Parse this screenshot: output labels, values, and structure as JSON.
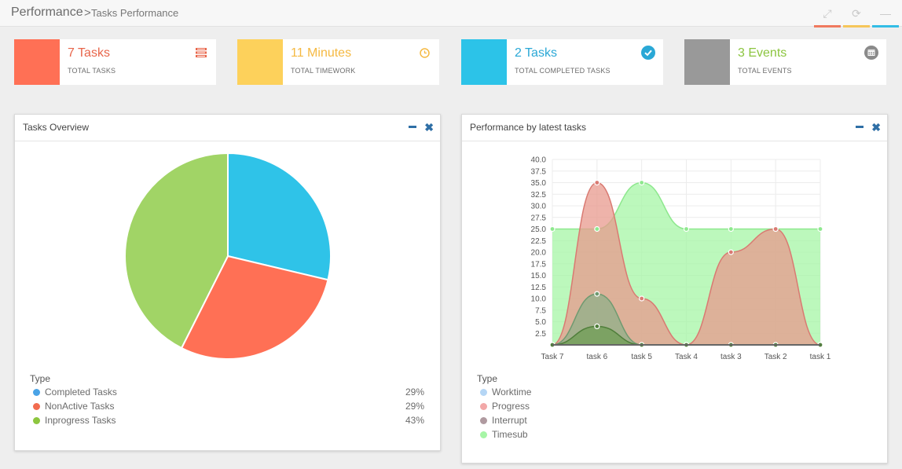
{
  "breadcrumb": {
    "main": "Performance",
    "separator": ">",
    "sub": "Tasks Performance"
  },
  "toolbar": {
    "buttons": [
      {
        "name": "fullscreen",
        "icon": "expand-icon",
        "glyph": "⤢",
        "accent": "#f07a5f"
      },
      {
        "name": "refresh",
        "icon": "refresh-icon",
        "glyph": "⟳",
        "accent": "#f6c65a"
      },
      {
        "name": "collapse",
        "icon": "minus-icon",
        "glyph": "—",
        "accent": "#33bde6"
      }
    ]
  },
  "stats": [
    {
      "value": "7 Tasks",
      "label": "TOTAL TASKS",
      "color": "#ff7055",
      "value_color": "#e8654a",
      "icon": "list-icon"
    },
    {
      "value": "11 Minutes",
      "label": "TOTAL TIMEWORK",
      "color": "#fdd15b",
      "value_color": "#f5b942",
      "icon": "clock-icon"
    },
    {
      "value": "2 Tasks",
      "label": "TOTAL COMPLETED TASKS",
      "color": "#2cc3e8",
      "value_color": "#2aa8d6",
      "icon": "check-circle-icon"
    },
    {
      "value": "3 Events",
      "label": "TOTAL EVENTS",
      "color": "#999999",
      "value_color": "#8cc540",
      "icon": "calendar-icon"
    }
  ],
  "overview": {
    "title": "Tasks Overview",
    "legend_title": "Type",
    "legend": [
      {
        "name": "Completed Tasks",
        "pct": "29%",
        "color": "#4aa3e6"
      },
      {
        "name": "NonActive Tasks",
        "pct": "29%",
        "color": "#f26c4f"
      },
      {
        "name": "Inprogress Tasks",
        "pct": "43%",
        "color": "#8dc63f"
      }
    ]
  },
  "performance": {
    "title": "Performance by latest tasks",
    "legend_title": "Type",
    "legend": [
      {
        "name": "Worktime",
        "color": "#b5d6f5"
      },
      {
        "name": "Progress",
        "color": "#f2a8a8"
      },
      {
        "name": "Interrupt",
        "color": "#b09aa0"
      },
      {
        "name": "Timesub",
        "color": "#a6f5a6"
      }
    ]
  },
  "chart_data": [
    {
      "type": "pie",
      "labels": [
        "Completed Tasks",
        "NonActive Tasks",
        "Inprogress Tasks"
      ],
      "values": [
        29,
        29,
        43
      ],
      "slice_colors": [
        "#2fc3e8",
        "#ff7055",
        "#a1d466"
      ]
    },
    {
      "type": "area",
      "categories": [
        "Task 7",
        "task 6",
        "task 5",
        "Task 4",
        "task 3",
        "Task 2",
        "task 1"
      ],
      "ylim": [
        0,
        40
      ],
      "yticks": [
        "2.5",
        "5.0",
        "7.5",
        "10.0",
        "12.5",
        "15.0",
        "17.5",
        "20.0",
        "22.5",
        "25.0",
        "27.5",
        "30.0",
        "32.5",
        "35.0",
        "37.5",
        "40.0"
      ],
      "series": [
        {
          "name": "Timesub",
          "values": [
            25,
            25,
            35,
            25,
            25,
            25,
            25
          ],
          "fill": "#a6f5a6",
          "stroke": "#8ee88e"
        },
        {
          "name": "Progress",
          "values": [
            0,
            35,
            10,
            0,
            20,
            25,
            0
          ],
          "fill": "#e89a8e",
          "stroke": "#d97a72"
        },
        {
          "name": "Interrupt",
          "values": [
            0,
            11,
            0,
            0,
            0,
            0,
            0
          ],
          "fill": "#8fb08a",
          "stroke": "#6f9a70"
        },
        {
          "name": "Worktime",
          "values": [
            0,
            4,
            0,
            0,
            0,
            0,
            0
          ],
          "fill": "#6f9e55",
          "stroke": "#4f7e3a"
        }
      ]
    }
  ]
}
